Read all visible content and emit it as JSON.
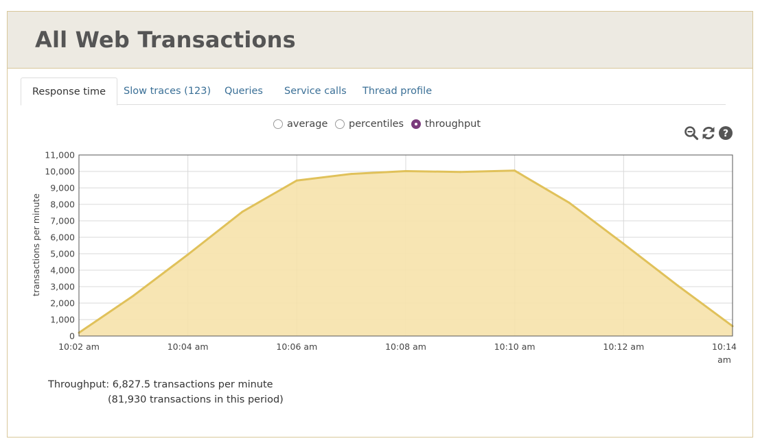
{
  "header": {
    "title": "All Web Transactions"
  },
  "tabs": [
    {
      "label": "Response time",
      "active": true
    },
    {
      "label": "Slow traces (123)",
      "active": false
    },
    {
      "label": "Queries",
      "active": false
    },
    {
      "label": "Service calls",
      "active": false
    },
    {
      "label": "Thread profile",
      "active": false
    }
  ],
  "view_options": [
    {
      "label": "average",
      "checked": false
    },
    {
      "label": "percentiles",
      "checked": false
    },
    {
      "label": "throughput",
      "checked": true
    }
  ],
  "toolbar": {
    "icons": [
      "zoom-out-icon",
      "refresh-icon",
      "help-icon"
    ]
  },
  "colors": {
    "accent": "#7b3b7c",
    "area_fill": "#f6e2ab",
    "area_line": "#e0c15a",
    "link": "#3a6f96"
  },
  "chart_data": {
    "type": "area",
    "ylabel": "transactions per minute",
    "xlabel": "",
    "ylim": [
      0,
      11000
    ],
    "yticks": [
      0,
      1000,
      2000,
      3000,
      4000,
      5000,
      6000,
      7000,
      8000,
      9000,
      10000,
      11000
    ],
    "ytick_labels": [
      "0",
      "1,000",
      "2,000",
      "3,000",
      "4,000",
      "5,000",
      "6,000",
      "7,000",
      "8,000",
      "9,000",
      "10,000",
      "11,000"
    ],
    "xtick_labels": [
      "10:02 am",
      "10:04 am",
      "10:06 am",
      "10:08 am",
      "10:10 am",
      "10:12 am",
      "10:14 am"
    ],
    "x": [
      "10:02 am",
      "10:03 am",
      "10:04 am",
      "10:05 am",
      "10:06 am",
      "10:07 am",
      "10:08 am",
      "10:09 am",
      "10:10 am",
      "10:11 am",
      "10:12 am",
      "10:13 am",
      "10:14 am"
    ],
    "values": [
      200,
      2450,
      4950,
      7550,
      9450,
      9850,
      10020,
      9970,
      10050,
      8100,
      5600,
      3050,
      600
    ],
    "grid": true,
    "legend": "none"
  },
  "summary": {
    "line1": "Throughput: 6,827.5 transactions per minute",
    "line2": "(81,930 transactions in this period)"
  }
}
